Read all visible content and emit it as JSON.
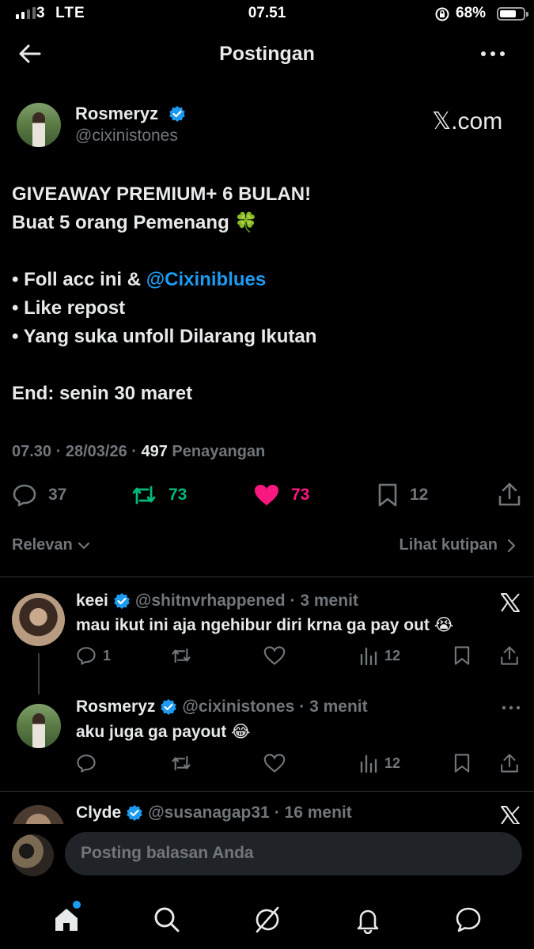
{
  "status_bar": {
    "carrier": "3",
    "network": "LTE",
    "time": "07.51",
    "battery_percent": "68%"
  },
  "header": {
    "title": "Postingan"
  },
  "post": {
    "author_name": "Rosmeryz",
    "author_handle": "@cixinistones",
    "source_label": "𝕏.com",
    "line1": "GIVEAWAY PREMIUM+ 6 BULAN!",
    "line2": "Buat 5 orang Pemenang 🍀",
    "bullet1_prefix": "• Foll acc ini & ",
    "bullet1_mention": "@Cixiniblues",
    "bullet2": "• Like repost",
    "bullet3": "• Yang suka unfoll Dilarang Ikutan",
    "end_line": "End: senin 30 maret",
    "time": "07.30",
    "date": "28/03/26",
    "views_count": "497",
    "views_label": "Penayangan",
    "replies": "37",
    "reposts": "73",
    "likes": "73",
    "bookmarks": "12"
  },
  "filter": {
    "sort_label": "Relevan",
    "quotes_label": "Lihat kutipan"
  },
  "replies": [
    {
      "name": "keei",
      "handle": "@shitnvrhappened",
      "time": "· 3 menit",
      "text": "mau ikut ini aja ngehibur diri krna ga pay out 😭",
      "reply_count": "1",
      "views": "12"
    },
    {
      "name": "Rosmeryz",
      "handle": "@cixinistones",
      "time": "· 3 menit",
      "text": "aku juga ga payout 😂",
      "views": "12"
    },
    {
      "name": "Clyde",
      "handle": "@susanagap31",
      "time": "· 16 menit"
    }
  ],
  "compose": {
    "placeholder": "Posting balasan Anda"
  },
  "colors": {
    "background": "#000000",
    "accent_blue": "#1d9bf0",
    "repost_green": "#00ba7c",
    "like_pink": "#f91880",
    "muted_grey": "#71767b"
  },
  "nav_icons": [
    "home-icon",
    "search-icon",
    "grok-icon",
    "notifications-icon",
    "messages-icon"
  ]
}
